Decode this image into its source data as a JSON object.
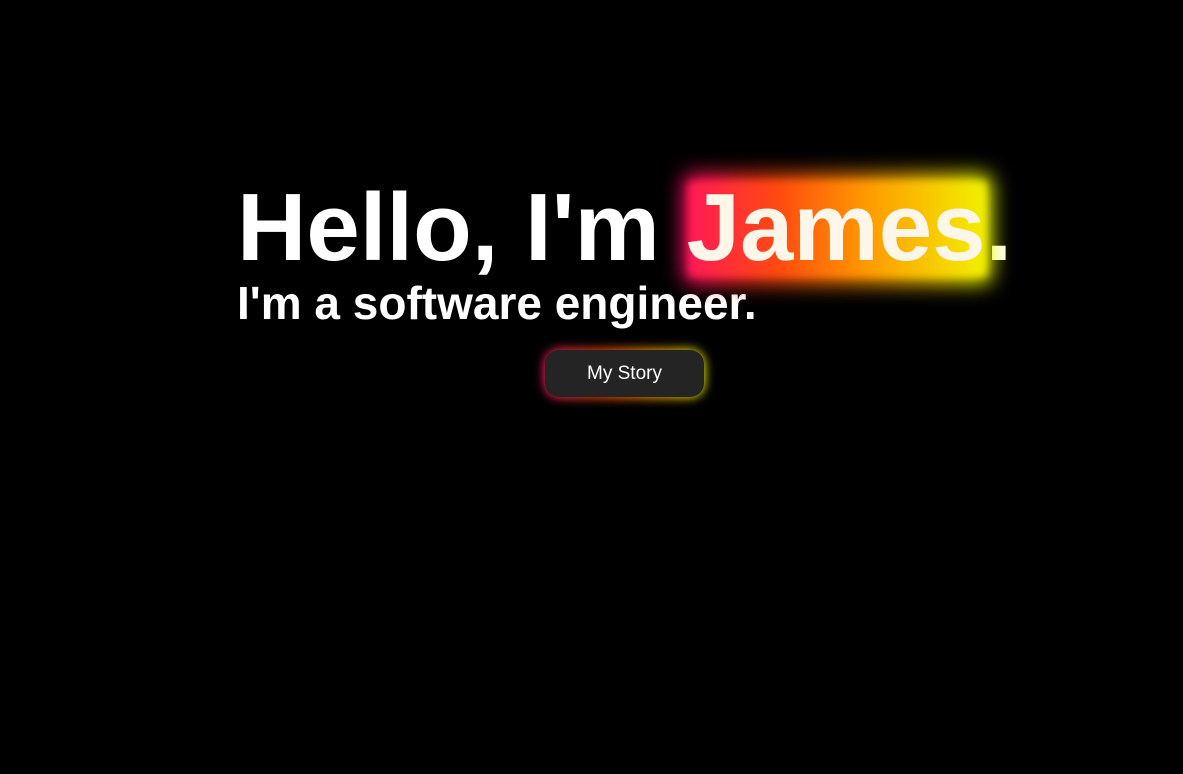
{
  "hero": {
    "greeting": "Hello, I'm ",
    "name": "James",
    "name_suffix": ".",
    "tagline": "I'm a software engineer.",
    "cta_label": "My Story"
  },
  "colors": {
    "background": "#000000",
    "text": "#ffffff",
    "button_bg": "#242424",
    "glow_gradient": [
      "#ff0a6a",
      "#ff3b12",
      "#ff8a00",
      "#ffd000",
      "#e6ff00"
    ]
  }
}
